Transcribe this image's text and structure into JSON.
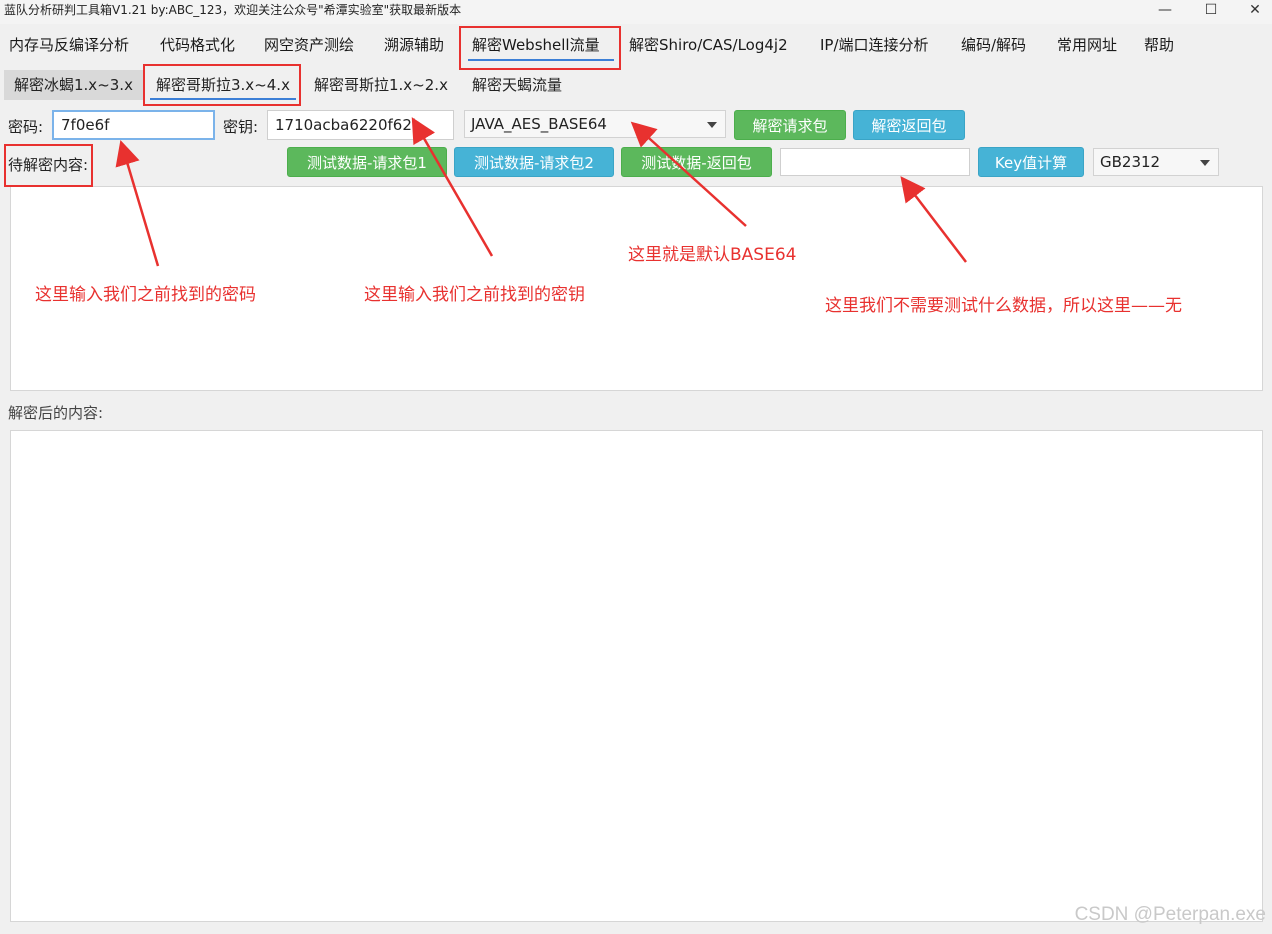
{
  "window": {
    "title": "蓝队分析研判工具箱V1.21 by:ABC_123，欢迎关注公众号\"希潭实验室\"获取最新版本",
    "minimize": "—",
    "maximize": "☐",
    "close": "✕"
  },
  "menu": {
    "items": [
      "内存马反编译分析",
      "代码格式化",
      "网空资产测绘",
      "溯源辅助",
      "解密Webshell流量",
      "解密Shiro/CAS/Log4j2",
      "IP/端口连接分析",
      "编码/解码",
      "常用网址",
      "帮助"
    ],
    "active_index": 4
  },
  "subtabs": {
    "items": [
      "解密冰蝎1.x~3.x",
      "解密哥斯拉3.x~4.x",
      "解密哥斯拉1.x~2.x",
      "解密天蝎流量"
    ],
    "active_index": 1
  },
  "form": {
    "password_label": "密码:",
    "password_value": "7f0e6f",
    "key_label": "密钥:",
    "key_value": "1710acba6220f62b",
    "mode_selected": "JAVA_AES_BASE64",
    "decrypt_request_button": "解密请求包",
    "decrypt_response_button": "解密返回包",
    "pending_label": "待解密内容:",
    "test_request1_button": "测试数据-请求包1",
    "test_request2_button": "测试数据-请求包2",
    "test_response_button": "测试数据-返回包",
    "key_calc_input": "",
    "key_calc_button": "Key值计算",
    "encoding_selected": "GB2312",
    "result_label": "解密后的内容:"
  },
  "annotations": {
    "password_note": "这里输入我们之前找到的密码",
    "key_note": "这里输入我们之前找到的密钥",
    "mode_note": "这里就是默认BASE64",
    "test_note": "这里我们不需要测试什么数据，所以这里——无"
  },
  "watermark": "CSDN @Peterpan.exe",
  "colors": {
    "annotation_red": "#e8312f",
    "green_button": "#5cb85c",
    "blue_button": "#46b3d6",
    "tab_underline": "#3c7fd6"
  }
}
